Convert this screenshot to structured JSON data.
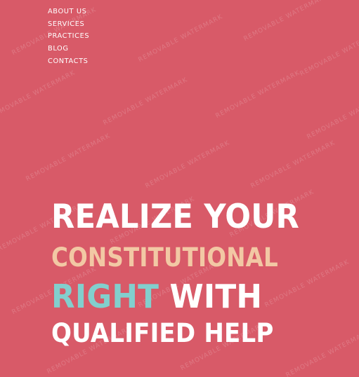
{
  "nav": {
    "items": [
      {
        "label": "ABOUT US"
      },
      {
        "label": "SERVICES"
      },
      {
        "label": "PRACTICES"
      },
      {
        "label": "BLOG"
      },
      {
        "label": "CONTACTS"
      }
    ]
  },
  "hero": {
    "line1": "REALIZE YOUR",
    "line2": "CONSTITUTIONAL",
    "line3_accent": "RIGHT",
    "line3_rest": " WITH",
    "line4": "QUALIFIED HELP"
  },
  "watermark": {
    "text": "REMOVABLE WATERMARK"
  },
  "colors": {
    "background": "#d85a68",
    "accent_peach": "#f2c8a4",
    "accent_teal": "#82cfcd",
    "text": "#ffffff"
  }
}
